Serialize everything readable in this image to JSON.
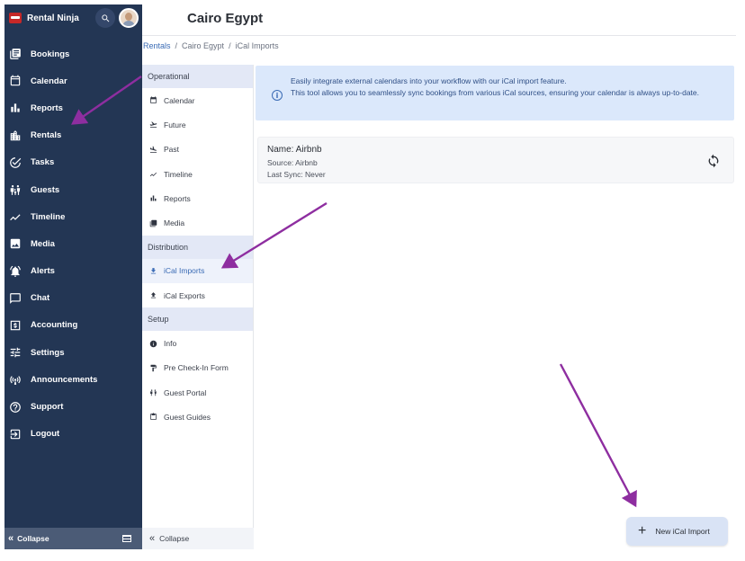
{
  "app": {
    "brand": "Rental Ninja"
  },
  "sidebar": {
    "items": [
      {
        "label": "Bookings",
        "icon": "bookings-icon"
      },
      {
        "label": "Calendar",
        "icon": "calendar-icon"
      },
      {
        "label": "Reports",
        "icon": "reports-icon"
      },
      {
        "label": "Rentals",
        "icon": "rentals-icon"
      },
      {
        "label": "Tasks",
        "icon": "tasks-icon"
      },
      {
        "label": "Guests",
        "icon": "guests-icon"
      },
      {
        "label": "Timeline",
        "icon": "timeline-icon"
      },
      {
        "label": "Media",
        "icon": "media-icon"
      },
      {
        "label": "Alerts",
        "icon": "alerts-icon"
      },
      {
        "label": "Chat",
        "icon": "chat-icon"
      },
      {
        "label": "Accounting",
        "icon": "accounting-icon"
      },
      {
        "label": "Settings",
        "icon": "settings-icon"
      },
      {
        "label": "Announcements",
        "icon": "announcements-icon"
      },
      {
        "label": "Support",
        "icon": "support-icon"
      },
      {
        "label": "Logout",
        "icon": "logout-icon"
      }
    ],
    "collapse_label": "Collapse"
  },
  "header": {
    "title": "Cairo Egypt"
  },
  "breadcrumb": {
    "root": "Rentals",
    "rental": "Cairo Egypt",
    "current": "iCal Imports"
  },
  "subnav": {
    "sections": {
      "operational": "Operational",
      "distribution": "Distribution",
      "setup": "Setup"
    },
    "operational": [
      "Calendar",
      "Future",
      "Past",
      "Timeline",
      "Reports",
      "Media"
    ],
    "distribution": [
      "iCal Imports",
      "iCal Exports"
    ],
    "setup": [
      "Info",
      "Pre Check-In Form",
      "Guest Portal",
      "Guest Guides"
    ],
    "collapse_label": "Collapse"
  },
  "content": {
    "info_line1": "Easily integrate external calendars into your workflow with our iCal import feature.",
    "info_line2": "This tool allows you to seamlessly sync bookings from various iCal sources, ensuring your calendar is always up-to-date.",
    "card": {
      "name": "Name: Airbnb",
      "source": "Source: Airbnb",
      "last_sync": "Last Sync: Never"
    },
    "new_button": "New iCal Import"
  },
  "colors": {
    "sidebar_bg": "#233654",
    "accent": "#3a6bb5",
    "banner_bg": "#dbe8fb",
    "annotation_arrow": "#8e2ea0"
  }
}
